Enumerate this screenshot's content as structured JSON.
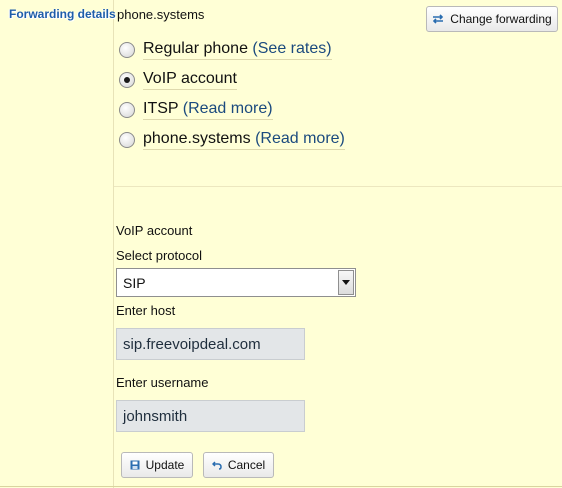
{
  "sidebar": {
    "title": "Forwarding details"
  },
  "header": {
    "value": "phone.systems",
    "change_button": "Change forwarding"
  },
  "options": [
    {
      "label": "Regular phone",
      "link": "(See rates)",
      "selected": false
    },
    {
      "label": "VoIP account",
      "link": "",
      "selected": true
    },
    {
      "label": "ITSP",
      "link": "(Read more)",
      "selected": false
    },
    {
      "label": "phone.systems",
      "link": "(Read more)",
      "selected": false
    }
  ],
  "form": {
    "section_title": "VoIP account",
    "protocol_label": "Select protocol",
    "protocol_value": "SIP",
    "host_label": "Enter host",
    "host_value": "sip.freevoipdeal.com",
    "username_label": "Enter username",
    "username_value": "johnsmith"
  },
  "actions": {
    "update": "Update",
    "cancel": "Cancel"
  }
}
